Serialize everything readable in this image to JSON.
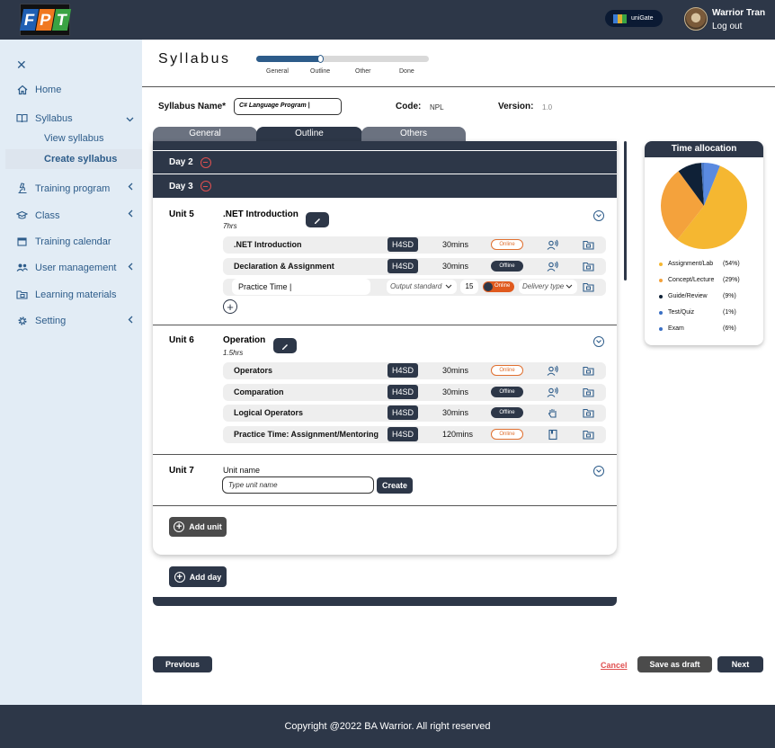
{
  "header": {
    "logo_letters": [
      "F",
      "P",
      "T"
    ],
    "unigate_label": "uniGate",
    "user_name": "Warrior Tran",
    "logout": "Log out"
  },
  "sidebar": {
    "items": [
      {
        "label": "Home",
        "icon": "home-icon"
      },
      {
        "label": "Syllabus",
        "icon": "book-icon"
      },
      {
        "label": "Training program",
        "icon": "microscope-icon"
      },
      {
        "label": "Class",
        "icon": "graduation-icon"
      },
      {
        "label": "Training calendar",
        "icon": "calendar-icon"
      },
      {
        "label": "User management",
        "icon": "users-icon"
      },
      {
        "label": "Learning materials",
        "icon": "folder-icon"
      },
      {
        "label": "Setting",
        "icon": "gear-icon"
      }
    ],
    "sub_items": [
      "View syllabus",
      "Create syllabus"
    ]
  },
  "page": {
    "title": "Syllabus",
    "steps": [
      "General",
      "Outline",
      "Other",
      "Done"
    ],
    "progress": 0.375
  },
  "form": {
    "name_label": "Syllabus Name*",
    "name_value": "C# Language Program |",
    "code_label": "Code:",
    "code_value": "NPL",
    "version_label": "Version:",
    "version_value": "1.0"
  },
  "tabs": [
    "General",
    "Outline",
    "Others"
  ],
  "days": [
    "Day 2",
    "Day 3"
  ],
  "units": [
    {
      "label": "Unit 5",
      "title": ".NET Introduction",
      "hours": "7hrs",
      "lessons": [
        {
          "name": ".NET Introduction",
          "std": "H4SD",
          "dur": "30mins",
          "mode": "Online",
          "dtype": "voice"
        },
        {
          "name": "Declaration & Assignment",
          "std": "H4SD",
          "dur": "30mins",
          "mode": "Offline",
          "dtype": "voice"
        }
      ],
      "new_lesson": {
        "name": "Practice Time |",
        "output_placeholder": "Output standard",
        "duration": "15",
        "toggle": "Online",
        "delivery_placeholder": "Delivery type"
      }
    },
    {
      "label": "Unit 6",
      "title": "Operation",
      "hours": "1.5hrs",
      "lessons": [
        {
          "name": "Operators",
          "std": "H4SD",
          "dur": "30mins",
          "mode": "Online",
          "dtype": "voice"
        },
        {
          "name": "Comparation",
          "std": "H4SD",
          "dur": "30mins",
          "mode": "Offline",
          "dtype": "voice"
        },
        {
          "name": "Logical Operators",
          "std": "H4SD",
          "dur": "30mins",
          "mode": "Offline",
          "dtype": "hand"
        },
        {
          "name": "Practice Time: Assignment/Mentoring",
          "std": "H4SD",
          "dur": "120mins",
          "mode": "Online",
          "dtype": "book"
        }
      ]
    },
    {
      "label": "Unit 7",
      "name_label": "Unit name",
      "placeholder": "Type unit name",
      "create": "Create"
    }
  ],
  "add_unit": "Add unit",
  "add_day": "Add day",
  "time_allocation": {
    "title": "Time allocation",
    "chart_data": {
      "type": "pie",
      "labels": [
        "Assignment/Lab",
        "Concept/Lecture",
        "Guide/Review",
        "Test/Quiz",
        "Exam"
      ],
      "values": [
        54,
        29,
        9,
        1,
        6
      ],
      "display": [
        "(54%)",
        "(29%)",
        "(9%)",
        "(1%)",
        "(6%)"
      ],
      "colors": [
        "#f5b731",
        "#f4a23c",
        "#0f2137",
        "#4a78c4",
        "#5a8ae0"
      ]
    }
  },
  "buttons": {
    "previous": "Previous",
    "cancel": "Cancel",
    "save_draft": "Save as draft",
    "next": "Next"
  },
  "footer": "Copyright @2022 BA Warrior. All right reserved",
  "colors": {
    "dark": "#2d3748",
    "accent": "#2d5c8a",
    "online": "#e07030",
    "danger": "#e05050"
  }
}
